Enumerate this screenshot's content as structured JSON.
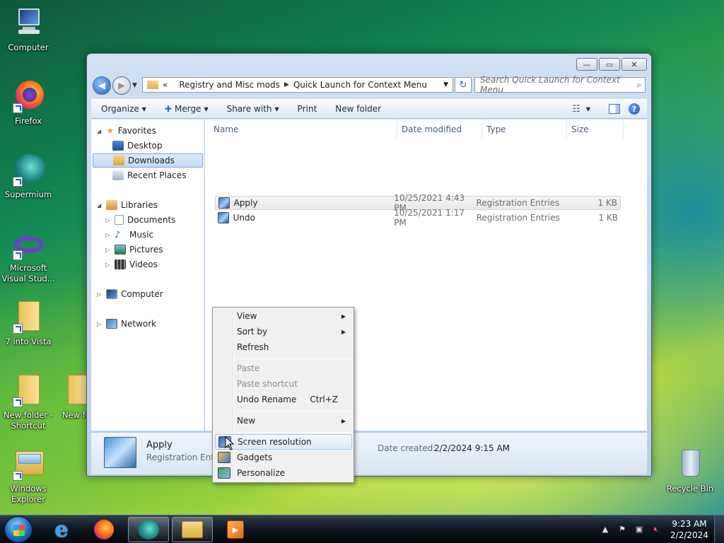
{
  "desktop": {
    "icons": [
      {
        "label": "Computer"
      },
      {
        "label": "Firefox"
      },
      {
        "label": "Supermium"
      },
      {
        "label": "Microsoft Visual Stud..."
      },
      {
        "label": "7 into Vista"
      },
      {
        "label": "New folder - Shortcut"
      },
      {
        "label": "New fo..."
      },
      {
        "label": "Windows Explorer"
      },
      {
        "label": "Recycle Bin"
      }
    ]
  },
  "window": {
    "caption": {
      "minimize": "—",
      "maximize": "▭",
      "close": "✕"
    },
    "address": {
      "prefix": "«",
      "crumb1": "Registry and Misc mods",
      "crumb2": "Quick Launch for Context Menu"
    },
    "search_placeholder": "Search Quick Launch for Context Menu",
    "toolbar": {
      "organize": "Organize",
      "merge": "Merge",
      "share": "Share with",
      "print": "Print",
      "newfolder": "New folder"
    },
    "nav": {
      "favorites": "Favorites",
      "desktop": "Desktop",
      "downloads": "Downloads",
      "recent": "Recent Places",
      "libraries": "Libraries",
      "documents": "Documents",
      "music": "Music",
      "pictures": "Pictures",
      "videos": "Videos",
      "computer": "Computer",
      "network": "Network"
    },
    "columns": {
      "name": "Name",
      "date": "Date modified",
      "type": "Type",
      "size": "Size"
    },
    "files": [
      {
        "name": "Apply",
        "date": "10/25/2021 4:43 PM",
        "type": "Registration Entries",
        "size": "1 KB"
      },
      {
        "name": "Undo",
        "date": "10/25/2021 1:17 PM",
        "type": "Registration Entries",
        "size": "1 KB"
      }
    ],
    "details": {
      "name": "Apply",
      "type": "Registration Entri",
      "created_label": "Date created:",
      "created_value": "2/2/2024 9:15 AM"
    }
  },
  "context_menu": {
    "view": "View",
    "sortby": "Sort by",
    "refresh": "Refresh",
    "paste": "Paste",
    "paste_shortcut": "Paste shortcut",
    "undo_rename": "Undo Rename",
    "undo_shortcut": "Ctrl+Z",
    "new": "New",
    "screen_resolution": "Screen resolution",
    "gadgets": "Gadgets",
    "personalize": "Personalize"
  },
  "taskbar": {
    "clock_time": "9:23 AM",
    "clock_date": "2/2/2024"
  }
}
